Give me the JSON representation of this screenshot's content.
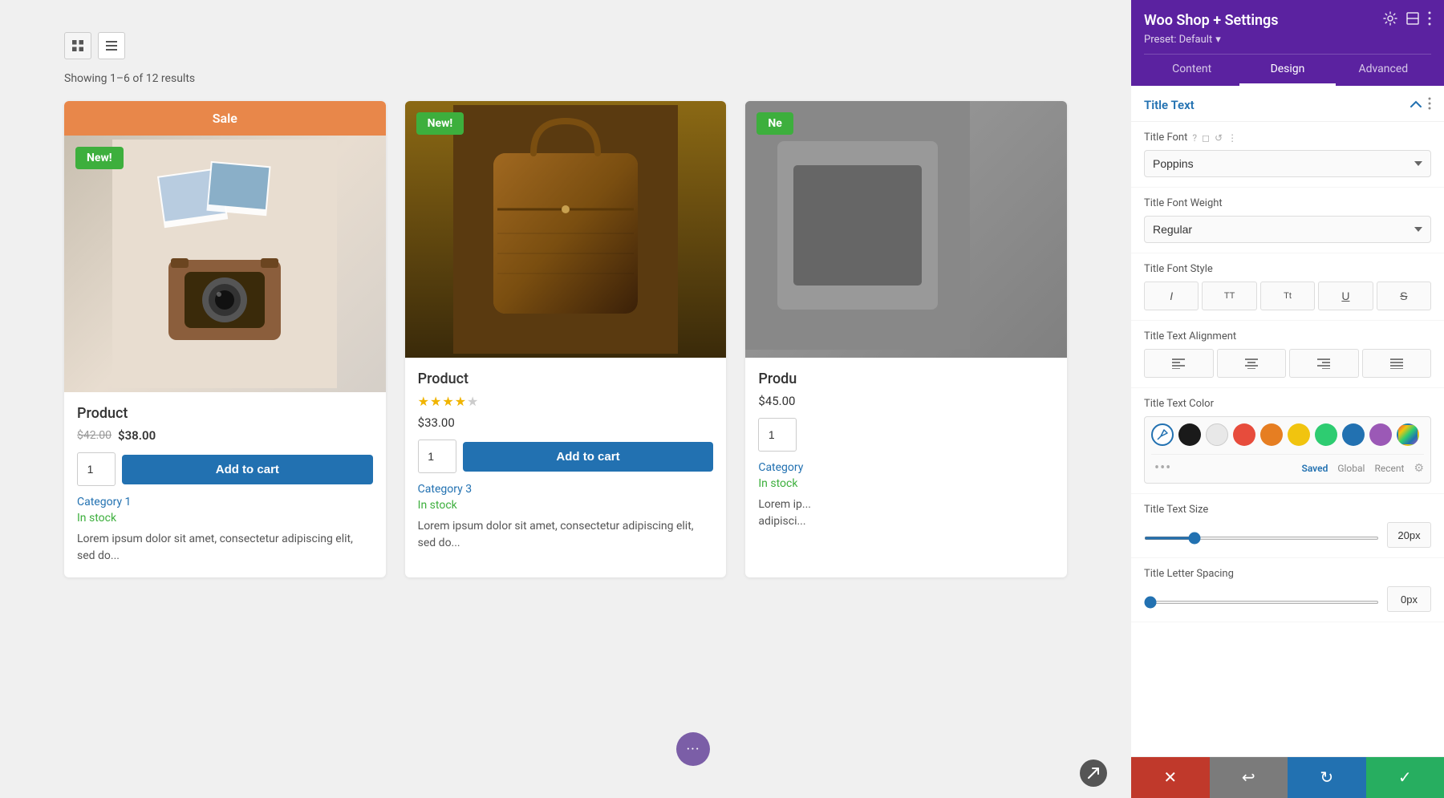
{
  "panel": {
    "title": "Woo Shop + Settings",
    "preset_label": "Preset: Default",
    "tabs": [
      {
        "id": "content",
        "label": "Content"
      },
      {
        "id": "design",
        "label": "Design",
        "active": true
      },
      {
        "id": "advanced",
        "label": "Advanced"
      }
    ],
    "section": {
      "title": "Title Text",
      "header_icons": [
        "chevron-up",
        "more-vert"
      ]
    },
    "settings": {
      "title_font": {
        "label": "Title Font",
        "value": "Poppins",
        "icons": [
          "question",
          "square",
          "reset",
          "more"
        ]
      },
      "title_font_weight": {
        "label": "Title Font Weight",
        "value": "Regular"
      },
      "title_font_style": {
        "label": "Title Font Style",
        "buttons": [
          "I",
          "TT",
          "Tt",
          "U",
          "S"
        ]
      },
      "title_text_alignment": {
        "label": "Title Text Alignment",
        "buttons": [
          "left",
          "center",
          "right",
          "justify"
        ]
      },
      "title_text_color": {
        "label": "Title Text Color",
        "colors": [
          "#ffffff",
          "#1a1a1a",
          "#e8e8e8",
          "#e74c3c",
          "#e67e22",
          "#f1c40f",
          "#2ecc71",
          "#2271b1",
          "#9b59b6",
          "gradient"
        ],
        "color_tabs": [
          "Saved",
          "Global",
          "Recent"
        ]
      },
      "title_text_size": {
        "label": "Title Text Size",
        "value": "20px",
        "slider_value": 20,
        "slider_min": 0,
        "slider_max": 100
      },
      "title_letter_spacing": {
        "label": "Title Letter Spacing",
        "value": "0px",
        "slider_value": 0,
        "slider_min": 0,
        "slider_max": 50
      }
    }
  },
  "main": {
    "toolbar": {
      "grid_icon": "grid",
      "list_icon": "list"
    },
    "showing_text": "Showing 1–6 of 12 results",
    "products": [
      {
        "id": 1,
        "has_sale_banner": true,
        "sale_banner_text": "Sale",
        "has_new_badge": true,
        "new_badge_text": "New!",
        "name": "Product",
        "price_old": "$42.00",
        "price_new": "$38.00",
        "stars": 0,
        "qty": 1,
        "add_to_cart": "Add to cart",
        "category": "Category 1",
        "stock": "In stock",
        "description": "Lorem ipsum dolor sit amet, consectetur adipiscing elit, sed do..."
      },
      {
        "id": 2,
        "has_sale_banner": false,
        "has_new_badge": true,
        "new_badge_text": "New!",
        "name": "Product",
        "price_regular": "$33.00",
        "stars": 3.5,
        "qty": 1,
        "add_to_cart": "Add to cart",
        "category": "Category 3",
        "stock": "In stock",
        "description": "Lorem ipsum dolor sit amet, consectetur adipiscing elit, sed do..."
      },
      {
        "id": 3,
        "has_sale_banner": false,
        "has_new_badge": true,
        "new_badge_text": "Ne",
        "name": "Produ",
        "price_regular": "$45.00",
        "stars": 0,
        "qty": 1,
        "add_to_cart": "Add to cart",
        "category": "Category",
        "stock": "In stock",
        "description": "Lorem ip... adipisci..."
      }
    ],
    "floating_dots": "···"
  },
  "actions": {
    "cancel": "✕",
    "undo": "↩",
    "redo": "↻",
    "save": "✓"
  }
}
